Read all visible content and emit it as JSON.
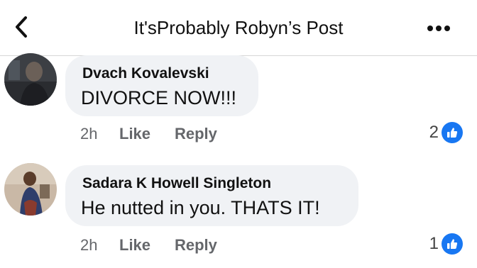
{
  "header": {
    "title": "It'sProbably Robyn’s Post",
    "back_icon": "chevron-left-icon",
    "more_icon": "more-horizontal-icon"
  },
  "comments": [
    {
      "author": "Dvach Kovalevski",
      "text": "DIVORCE NOW!!!",
      "time": "2h",
      "like_label": "Like",
      "reply_label": "Reply",
      "reaction_count": "2",
      "reaction_icon": "thumbs-up-icon"
    },
    {
      "author": "Sadara K Howell Singleton",
      "text": "He nutted in you. THATS IT!",
      "time": "2h",
      "like_label": "Like",
      "reply_label": "Reply",
      "reaction_count": "1",
      "reaction_icon": "thumbs-up-icon"
    }
  ],
  "colors": {
    "bubble": "#f0f2f5",
    "meta_text": "#65676b",
    "like_blue": "#1877f2"
  }
}
